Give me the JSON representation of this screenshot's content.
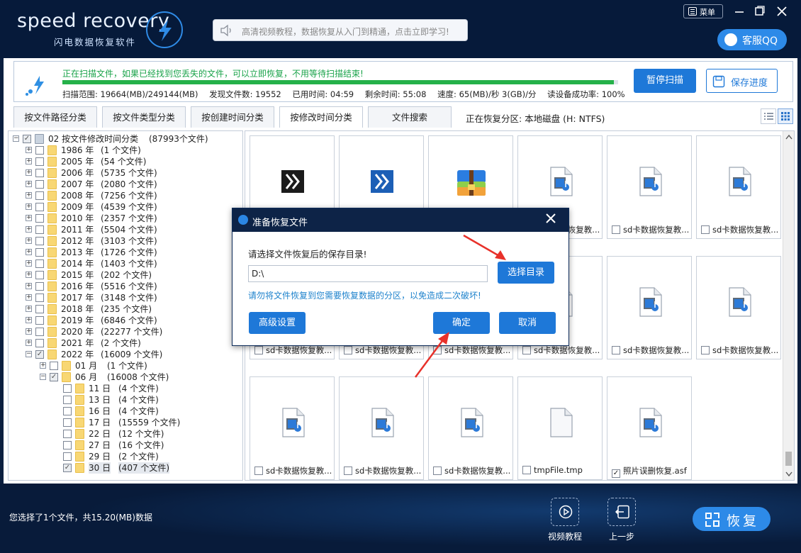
{
  "app": {
    "logo_text": "speed recovery",
    "logo_sub": "闪电数据恢复软件",
    "search_placeholder": "高清视频教程，数据恢复从入门到精通，点击立即学习!",
    "menu_label": "菜单",
    "qq_label": "客服QQ"
  },
  "status": {
    "line1": "正在扫描文件，如果已经找到您丢失的文件，可以立即恢复，不用等待扫描结束!",
    "progress_pct": 0.992,
    "scan_range": "扫描范围: 19664(MB)/249144(MB)",
    "found": "发现文件数: 19552",
    "elapsed": "已用时间: 04:59",
    "remaining": "剩余时间: 55:08",
    "speed": "速度: 65(MB)/秒  3(GB)/分",
    "success_rate": "读设备成功率: 100%",
    "pause_btn": "暂停扫描",
    "save_btn": "保存进度"
  },
  "tabs": [
    "按文件路径分类",
    "按文件类型分类",
    "按创建时间分类",
    "按修改时间分类",
    "文件搜索"
  ],
  "active_tab": 3,
  "partition_label": "正在恢复分区: 本地磁盘 (H: NTFS)",
  "tree": {
    "root": {
      "label": "02  按文件修改时间分类",
      "count": "(87993个文件)"
    },
    "years": [
      {
        "label": "1986 年",
        "count": "(1 个文件)"
      },
      {
        "label": "2005 年",
        "count": "(54 个文件)"
      },
      {
        "label": "2006 年",
        "count": "(5735 个文件)"
      },
      {
        "label": "2007 年",
        "count": "(2080 个文件)"
      },
      {
        "label": "2008 年",
        "count": "(7256 个文件)"
      },
      {
        "label": "2009 年",
        "count": "(4539 个文件)"
      },
      {
        "label": "2010 年",
        "count": "(2357 个文件)"
      },
      {
        "label": "2011 年",
        "count": "(5504 个文件)"
      },
      {
        "label": "2012 年",
        "count": "(3103 个文件)"
      },
      {
        "label": "2013 年",
        "count": "(1726 个文件)"
      },
      {
        "label": "2014 年",
        "count": "(1403 个文件)"
      },
      {
        "label": "2015 年",
        "count": "(202 个文件)"
      },
      {
        "label": "2016 年",
        "count": "(5516 个文件)"
      },
      {
        "label": "2017 年",
        "count": "(3148 个文件)"
      },
      {
        "label": "2018 年",
        "count": "(235 个文件)"
      },
      {
        "label": "2019 年",
        "count": "(6846 个文件)"
      },
      {
        "label": "2020 年",
        "count": "(22277 个文件)"
      },
      {
        "label": "2021 年",
        "count": "(2 个文件)"
      },
      {
        "label": "2022 年",
        "count": "(16009 个文件)"
      }
    ],
    "months": [
      {
        "label": "01 月",
        "count": "(1 个文件)"
      },
      {
        "label": "06 月",
        "count": "(16008 个文件)"
      }
    ],
    "days": [
      {
        "label": "11 日",
        "count": "(4 个文件)"
      },
      {
        "label": "13 日",
        "count": "(4 个文件)"
      },
      {
        "label": "16 日",
        "count": "(4 个文件)"
      },
      {
        "label": "17 日",
        "count": "(15559 个文件)"
      },
      {
        "label": "22 日",
        "count": "(12 个文件)"
      },
      {
        "label": "27 日",
        "count": "(16 个文件)"
      },
      {
        "label": "29 日",
        "count": "(2 个文件)"
      },
      {
        "label": "30 日",
        "count": "(407 个文件)"
      }
    ]
  },
  "files": [
    {
      "name": "",
      "icon": "chevron-dark-icon"
    },
    {
      "name": "",
      "icon": "chevron-blue-icon"
    },
    {
      "name": "",
      "icon": "zip-icon"
    },
    {
      "name": "sd卡数据恢复教...",
      "icon": "video-icon"
    },
    {
      "name": "sd卡数据恢复教...",
      "icon": "video-icon"
    },
    {
      "name": "sd卡数据恢复教...",
      "icon": "video-icon"
    },
    {
      "name": "sd卡数据恢复教...",
      "icon": "video-icon"
    },
    {
      "name": "sd卡数据恢复教...",
      "icon": "video-icon"
    },
    {
      "name": "sd卡数据恢复教...",
      "icon": "video-icon"
    },
    {
      "name": "sd卡数据恢复教...",
      "icon": "video-icon"
    },
    {
      "name": "sd卡数据恢复教...",
      "icon": "video-icon"
    },
    {
      "name": "sd卡数据恢复教...",
      "icon": "video-icon"
    },
    {
      "name": "sd卡数据恢复教...",
      "icon": "video-icon"
    },
    {
      "name": "sd卡数据恢复教...",
      "icon": "video-icon"
    },
    {
      "name": "sd卡数据恢复教...",
      "icon": "video-icon"
    },
    {
      "name": "tmpFile.tmp",
      "icon": "blank-file-icon"
    },
    {
      "name": "照片误删恢复.asf",
      "icon": "video-icon",
      "checked": true
    }
  ],
  "bottom": {
    "selection_info": "您选择了1个文件，共15.20(MB)数据",
    "video_tutorial": "视频教程",
    "back": "上一步",
    "recover": "恢复"
  },
  "dialog": {
    "title": "准备恢复文件",
    "question": "请选择文件恢复后的保存目录!",
    "path": "D:\\",
    "choose_dir": "选择目录",
    "warning": "请勿将文件恢复到您需要恢复数据的分区，以免造成二次破坏!",
    "advanced": "高级设置",
    "ok": "确定",
    "cancel": "取消"
  },
  "colors": {
    "accent": "#1e78d8",
    "header_bg": "#061a3a",
    "progress": "#25b149",
    "arrow": "#e8312a"
  }
}
